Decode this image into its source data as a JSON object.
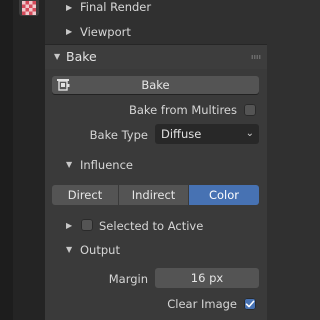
{
  "sections": {
    "final_render": "Final Render",
    "viewport": "Viewport"
  },
  "bake_panel": {
    "title": "Bake",
    "bake_button": "Bake",
    "bake_from_multires": {
      "label": "Bake from Multires",
      "checked": false
    },
    "bake_type": {
      "label": "Bake Type",
      "value": "Diffuse"
    },
    "influence": {
      "title": "Influence",
      "options": [
        "Direct",
        "Indirect",
        "Color"
      ],
      "active": "Color"
    },
    "selected_to_active": {
      "label": "Selected to Active",
      "checked": false
    },
    "output": {
      "title": "Output",
      "margin": {
        "label": "Margin",
        "value": "16 px"
      },
      "clear_image": {
        "label": "Clear Image",
        "checked": true
      }
    }
  },
  "colors": {
    "accent": "#4772b3",
    "panel_bg": "#3a3a3a",
    "header_bg": "#3d3d3d"
  },
  "icons": {
    "tab": "render-properties-icon",
    "bake_button": "bake-icon",
    "grip": "drag-grip-icon"
  }
}
